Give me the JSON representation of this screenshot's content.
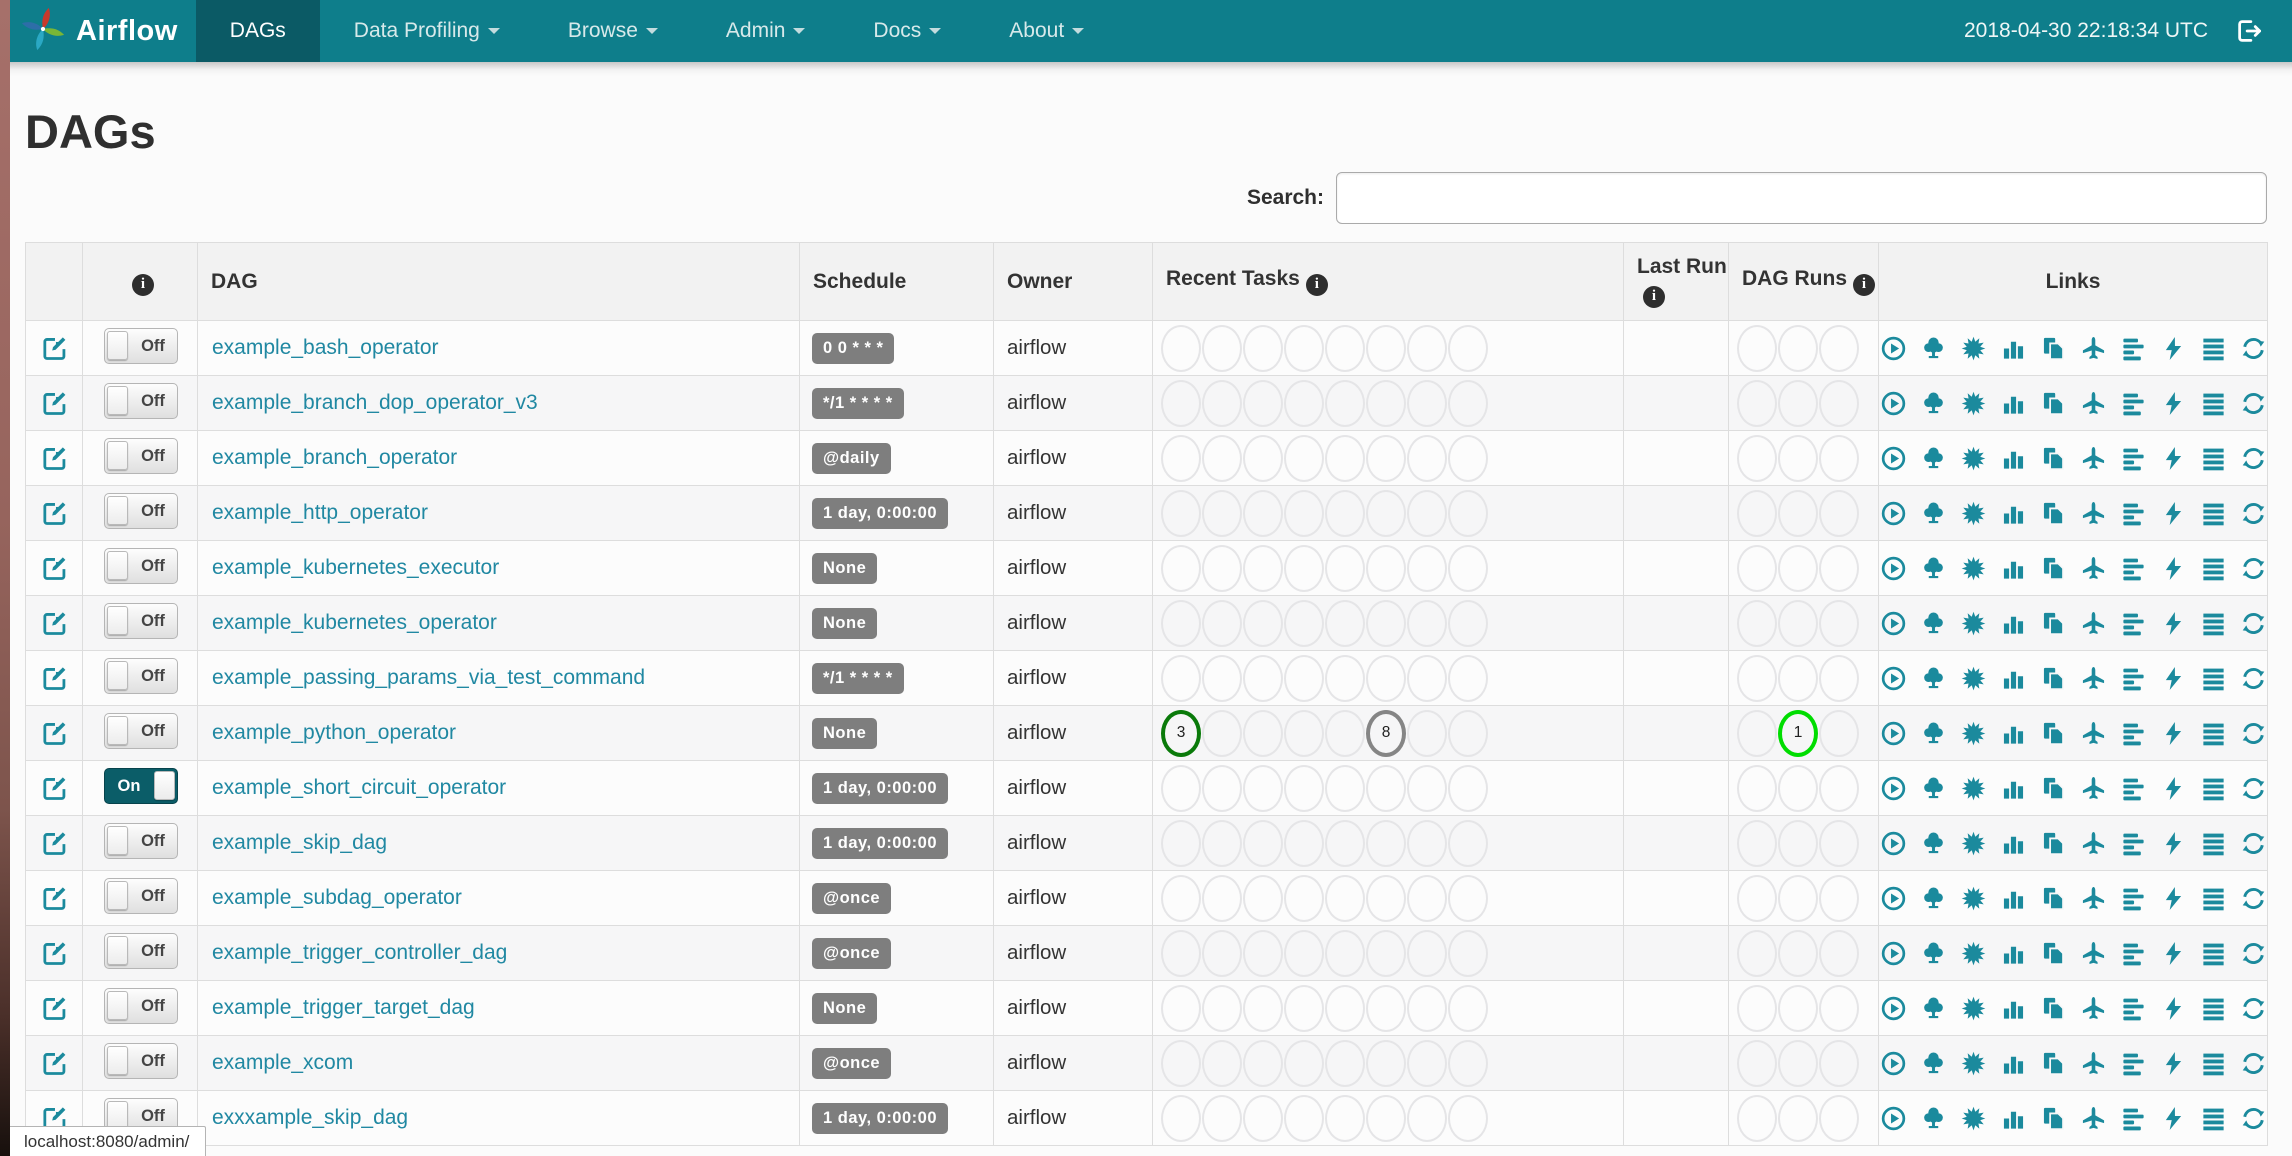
{
  "navbar": {
    "brand": "Airflow",
    "items": [
      {
        "label": "DAGs",
        "active": true,
        "caret": false
      },
      {
        "label": "Data Profiling",
        "active": false,
        "caret": true
      },
      {
        "label": "Browse",
        "active": false,
        "caret": true
      },
      {
        "label": "Admin",
        "active": false,
        "caret": true
      },
      {
        "label": "Docs",
        "active": false,
        "caret": true
      },
      {
        "label": "About",
        "active": false,
        "caret": true
      }
    ],
    "clock": "2018-04-30 22:18:34 UTC",
    "logout_icon": "sign-out-icon"
  },
  "page": {
    "title": "DAGs"
  },
  "search": {
    "label": "Search:",
    "value": ""
  },
  "table": {
    "headers": {
      "edit": "",
      "info_icon": "info-icon",
      "dag": "DAG",
      "schedule": "Schedule",
      "owner": "Owner",
      "recent_tasks": "Recent Tasks",
      "last_run": "Last Run",
      "dag_runs": "DAG Runs",
      "links": "Links"
    },
    "toggle_labels": {
      "on": "On",
      "off": "Off"
    },
    "recent_tasks_slots": 8,
    "dag_runs_slots": 3,
    "state_colors": {
      "success": "#0a7a0a",
      "running": "#00dd00",
      "queued": "#858585",
      "empty": "#e5e5e7"
    },
    "rows": [
      {
        "dag": "example_bash_operator",
        "enabled": false,
        "schedule": "0 0 * * *",
        "owner": "airflow",
        "recent_tasks": [],
        "dag_runs": [],
        "last_run": ""
      },
      {
        "dag": "example_branch_dop_operator_v3",
        "enabled": false,
        "schedule": "*/1 * * * *",
        "owner": "airflow",
        "recent_tasks": [],
        "dag_runs": [],
        "last_run": ""
      },
      {
        "dag": "example_branch_operator",
        "enabled": false,
        "schedule": "@daily",
        "owner": "airflow",
        "recent_tasks": [],
        "dag_runs": [],
        "last_run": ""
      },
      {
        "dag": "example_http_operator",
        "enabled": false,
        "schedule": "1 day, 0:00:00",
        "owner": "airflow",
        "recent_tasks": [],
        "dag_runs": [],
        "last_run": ""
      },
      {
        "dag": "example_kubernetes_executor",
        "enabled": false,
        "schedule": "None",
        "owner": "airflow",
        "recent_tasks": [],
        "dag_runs": [],
        "last_run": ""
      },
      {
        "dag": "example_kubernetes_operator",
        "enabled": false,
        "schedule": "None",
        "owner": "airflow",
        "recent_tasks": [],
        "dag_runs": [],
        "last_run": ""
      },
      {
        "dag": "example_passing_params_via_test_command",
        "enabled": false,
        "schedule": "*/1 * * * *",
        "owner": "airflow",
        "recent_tasks": [],
        "dag_runs": [],
        "last_run": ""
      },
      {
        "dag": "example_python_operator",
        "enabled": false,
        "schedule": "None",
        "owner": "airflow",
        "recent_tasks": [
          {
            "slot": 0,
            "count": 3,
            "state": "success"
          },
          {
            "slot": 5,
            "count": 8,
            "state": "queued"
          }
        ],
        "dag_runs": [
          {
            "slot": 1,
            "count": 1,
            "state": "running"
          }
        ],
        "last_run": ""
      },
      {
        "dag": "example_short_circuit_operator",
        "enabled": true,
        "schedule": "1 day, 0:00:00",
        "owner": "airflow",
        "recent_tasks": [],
        "dag_runs": [],
        "last_run": ""
      },
      {
        "dag": "example_skip_dag",
        "enabled": false,
        "schedule": "1 day, 0:00:00",
        "owner": "airflow",
        "recent_tasks": [],
        "dag_runs": [],
        "last_run": ""
      },
      {
        "dag": "example_subdag_operator",
        "enabled": false,
        "schedule": "@once",
        "owner": "airflow",
        "recent_tasks": [],
        "dag_runs": [],
        "last_run": ""
      },
      {
        "dag": "example_trigger_controller_dag",
        "enabled": false,
        "schedule": "@once",
        "owner": "airflow",
        "recent_tasks": [],
        "dag_runs": [],
        "last_run": ""
      },
      {
        "dag": "example_trigger_target_dag",
        "enabled": false,
        "schedule": "None",
        "owner": "airflow",
        "recent_tasks": [],
        "dag_runs": [],
        "last_run": ""
      },
      {
        "dag": "example_xcom",
        "enabled": false,
        "schedule": "@once",
        "owner": "airflow",
        "recent_tasks": [],
        "dag_runs": [],
        "last_run": ""
      },
      {
        "dag": "exxxample_skip_dag",
        "enabled": false,
        "schedule": "1 day, 0:00:00",
        "owner": "airflow",
        "recent_tasks": [],
        "dag_runs": [],
        "last_run": ""
      }
    ]
  },
  "links": {
    "items": [
      {
        "icon": "trigger-dag-icon",
        "label": "Trigger Dag"
      },
      {
        "icon": "tree-view-icon",
        "label": "Tree View"
      },
      {
        "icon": "graph-view-icon",
        "label": "Graph View"
      },
      {
        "icon": "task-duration-icon",
        "label": "Task Duration"
      },
      {
        "icon": "task-tries-icon",
        "label": "Task Tries"
      },
      {
        "icon": "landing-times-icon",
        "label": "Landing Times"
      },
      {
        "icon": "gantt-icon",
        "label": "Gantt"
      },
      {
        "icon": "code-view-icon",
        "label": "Code View"
      },
      {
        "icon": "dag-details-icon",
        "label": "DAG Details"
      },
      {
        "icon": "refresh-icon",
        "label": "Refresh"
      }
    ]
  },
  "status_bar": {
    "text": "localhost:8080/admin/"
  },
  "colors": {
    "accent": "#1b8a9d",
    "link": "#2088a2",
    "navbar": "#0e7e8b",
    "navbar_active": "#0b5a65",
    "badge": "#7e7e7e",
    "toggle_on": "#0b5d68"
  }
}
